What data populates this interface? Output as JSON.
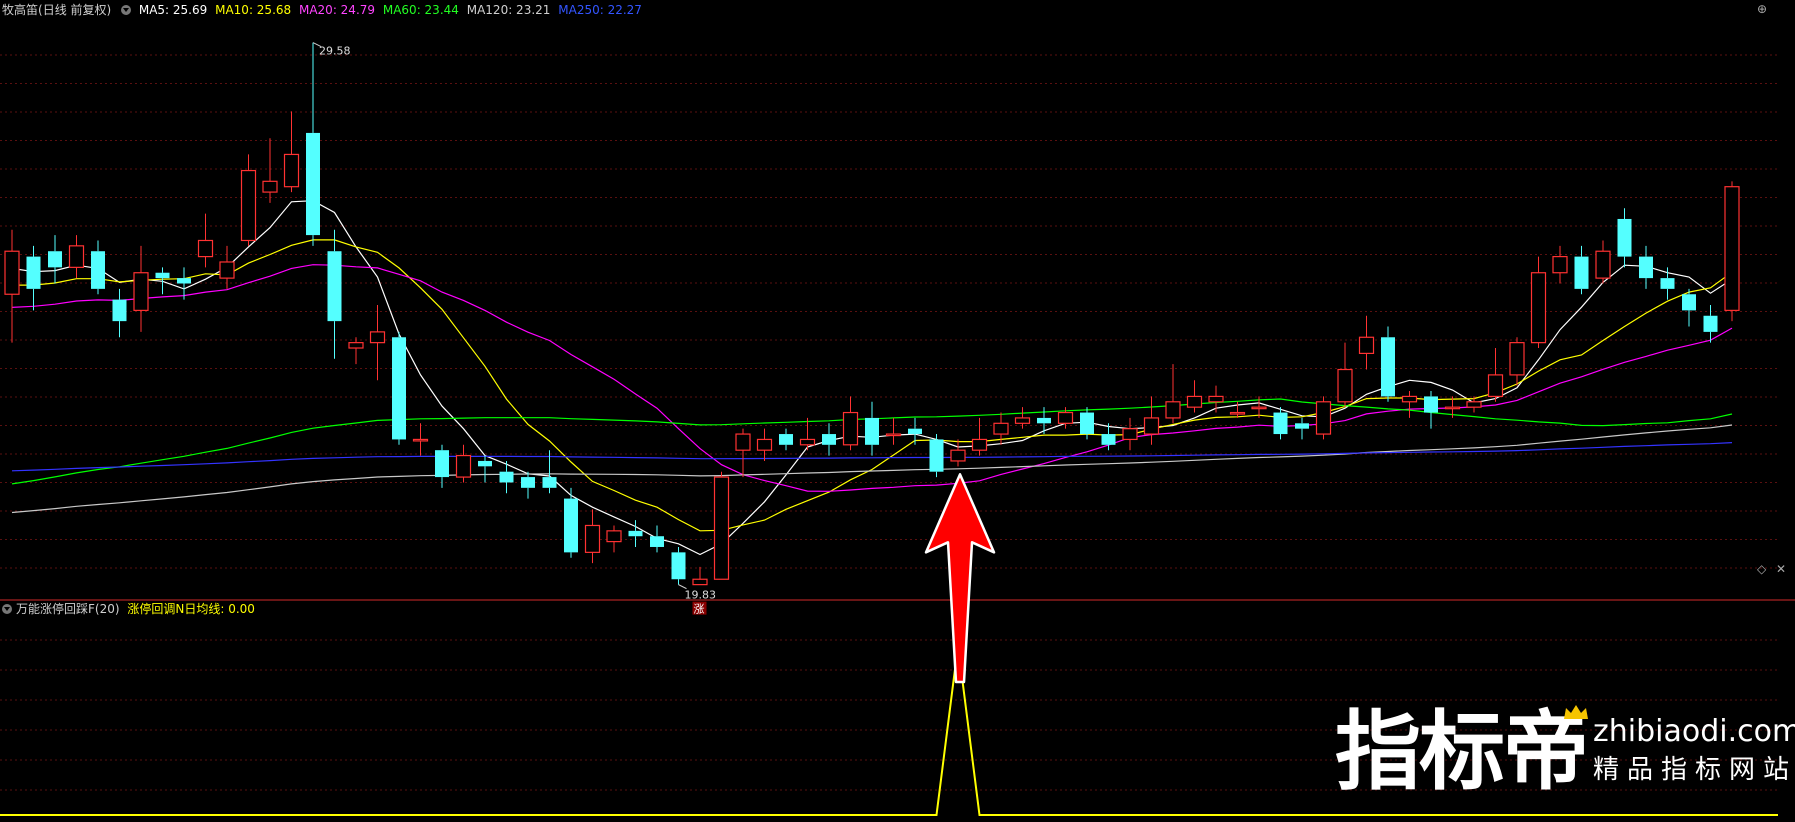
{
  "main_panel": {
    "stock_name": "牧高笛",
    "period": "(日线 前复权)",
    "ma": [
      {
        "label": "MA5: 25.69",
        "color": "#ffffff"
      },
      {
        "label": "MA10: 25.68",
        "color": "#ffff00"
      },
      {
        "label": "MA20: 24.79",
        "color": "#ff00ff"
      },
      {
        "label": "MA60: 23.44",
        "color": "#00ff00"
      },
      {
        "label": "MA120: 23.21",
        "color": "#c8c8c8"
      },
      {
        "label": "MA250: 22.27",
        "color": "#3333ff"
      }
    ],
    "high_label": "29.58",
    "low_label": "19.83",
    "limit_up_tag": "涨"
  },
  "sub_panel": {
    "indicator_name": "万能涨停回踩F(20)",
    "line_label": "涨停回调N日均线: 0.00"
  },
  "watermark": {
    "logo": "指标帝",
    "url": "zhibiaodi.com",
    "tagline": "精品指标网站"
  },
  "chart_data": {
    "type": "candlestick",
    "up_color": "#ff3232",
    "down_color": "#54ffff",
    "candles": [
      [
        24.9,
        25.7,
        26.1,
        24.0
      ],
      [
        25.6,
        25.0,
        25.8,
        24.6
      ],
      [
        25.7,
        25.4,
        26.0,
        25.1
      ],
      [
        25.4,
        25.8,
        26.0,
        25.2
      ],
      [
        25.7,
        25.0,
        25.9,
        24.9
      ],
      [
        24.8,
        24.4,
        25.0,
        24.1
      ],
      [
        24.6,
        25.3,
        25.8,
        24.2
      ],
      [
        25.3,
        25.2,
        25.4,
        24.9
      ],
      [
        25.2,
        25.1,
        25.4,
        24.8
      ],
      [
        25.6,
        25.9,
        26.4,
        25.4
      ],
      [
        25.2,
        25.5,
        25.8,
        25.0
      ],
      [
        25.9,
        27.2,
        27.5,
        25.8
      ],
      [
        26.8,
        27.0,
        27.8,
        26.6
      ],
      [
        26.9,
        27.5,
        28.3,
        26.8
      ],
      [
        27.9,
        26.0,
        29.58,
        25.8
      ],
      [
        25.7,
        24.4,
        26.1,
        23.7
      ],
      [
        23.9,
        24.0,
        24.1,
        23.6
      ],
      [
        24.0,
        24.2,
        24.7,
        23.3
      ],
      [
        24.1,
        22.2,
        24.2,
        22.1
      ],
      [
        22.2,
        22.2,
        22.5,
        21.9
      ],
      [
        22.0,
        21.5,
        22.1,
        21.3
      ],
      [
        21.5,
        21.9,
        22.1,
        21.4
      ],
      [
        21.8,
        21.7,
        21.9,
        21.4
      ],
      [
        21.6,
        21.4,
        21.8,
        21.2
      ],
      [
        21.5,
        21.3,
        21.6,
        21.1
      ],
      [
        21.5,
        21.3,
        22.0,
        21.2
      ],
      [
        21.1,
        20.1,
        21.3,
        20.0
      ],
      [
        20.1,
        20.6,
        20.9,
        19.9
      ],
      [
        20.3,
        20.5,
        20.6,
        20.1
      ],
      [
        20.5,
        20.4,
        20.7,
        20.2
      ],
      [
        20.4,
        20.2,
        20.6,
        20.1
      ],
      [
        20.1,
        19.6,
        20.2,
        19.5
      ],
      [
        19.5,
        19.6,
        19.8,
        19.83
      ],
      [
        19.6,
        21.5,
        21.6,
        19.6
      ],
      [
        22.0,
        22.3,
        22.4,
        21.5
      ],
      [
        22.0,
        22.2,
        22.4,
        21.8
      ],
      [
        22.3,
        22.1,
        22.4,
        22.0
      ],
      [
        22.1,
        22.2,
        22.6,
        22.0
      ],
      [
        22.3,
        22.1,
        22.5,
        21.9
      ],
      [
        22.1,
        22.7,
        23.0,
        22.0
      ],
      [
        22.6,
        22.1,
        22.9,
        21.9
      ],
      [
        22.3,
        22.3,
        22.6,
        22.1
      ],
      [
        22.4,
        22.3,
        22.6,
        22.1
      ],
      [
        22.2,
        21.6,
        22.3,
        21.5
      ],
      [
        21.8,
        22.0,
        22.2,
        21.7
      ],
      [
        22.0,
        22.2,
        22.6,
        21.9
      ],
      [
        22.3,
        22.5,
        22.7,
        22.1
      ],
      [
        22.5,
        22.6,
        22.8,
        22.4
      ],
      [
        22.6,
        22.5,
        22.8,
        22.3
      ],
      [
        22.5,
        22.7,
        22.8,
        22.4
      ],
      [
        22.7,
        22.3,
        22.8,
        22.2
      ],
      [
        22.3,
        22.1,
        22.5,
        22.0
      ],
      [
        22.2,
        22.4,
        22.6,
        22.0
      ],
      [
        22.3,
        22.6,
        23.0,
        22.1
      ],
      [
        22.6,
        22.9,
        23.6,
        22.5
      ],
      [
        22.8,
        23.0,
        23.3,
        22.7
      ],
      [
        22.9,
        23.0,
        23.2,
        22.7
      ],
      [
        22.7,
        22.7,
        22.9,
        22.6
      ],
      [
        22.8,
        22.8,
        23.0,
        22.6
      ],
      [
        22.7,
        22.3,
        22.8,
        22.2
      ],
      [
        22.5,
        22.4,
        22.6,
        22.2
      ],
      [
        22.3,
        22.9,
        23.0,
        22.2
      ],
      [
        22.9,
        23.5,
        24.0,
        22.8
      ],
      [
        23.8,
        24.1,
        24.5,
        23.5
      ],
      [
        24.1,
        23.0,
        24.3,
        22.9
      ],
      [
        22.9,
        23.0,
        23.1,
        22.6
      ],
      [
        23.0,
        22.7,
        23.1,
        22.4
      ],
      [
        22.8,
        22.8,
        23.0,
        22.6
      ],
      [
        22.8,
        22.9,
        23.0,
        22.7
      ],
      [
        23.0,
        23.4,
        23.9,
        22.9
      ],
      [
        23.4,
        24.0,
        24.1,
        23.2
      ],
      [
        24.0,
        25.3,
        25.6,
        23.9
      ],
      [
        25.3,
        25.6,
        25.8,
        25.1
      ],
      [
        25.6,
        25.0,
        25.8,
        24.9
      ],
      [
        25.2,
        25.7,
        25.9,
        25.1
      ],
      [
        26.3,
        25.6,
        26.5,
        25.4
      ],
      [
        25.6,
        25.2,
        25.8,
        25.0
      ],
      [
        25.2,
        25.0,
        25.4,
        24.8
      ],
      [
        24.9,
        24.6,
        25.0,
        24.3
      ],
      [
        24.5,
        24.2,
        24.7,
        24.0
      ],
      [
        24.6,
        26.9,
        27.0,
        24.4
      ]
    ],
    "ma_series": [
      {
        "name": "MA5",
        "color": "#ffffff"
      },
      {
        "name": "MA10",
        "color": "#ffff00"
      },
      {
        "name": "MA20",
        "color": "#ff00ff"
      },
      {
        "name": "MA60",
        "color": "#00ff00"
      },
      {
        "name": "MA120",
        "color": "#c8c8c8"
      },
      {
        "name": "MA250",
        "color": "#3333ff"
      }
    ],
    "ylim": [
      19.4,
      30.0
    ],
    "indicator": {
      "color": "#ffff00",
      "values": [
        0,
        0,
        0,
        0,
        0,
        0,
        0,
        0,
        0,
        0,
        0,
        0,
        0,
        0,
        0,
        0,
        0,
        0,
        0,
        0,
        0,
        0,
        0,
        0,
        0,
        0,
        0,
        0,
        0,
        0,
        0,
        0,
        0,
        0,
        0,
        0,
        0,
        0,
        0,
        0,
        0,
        0,
        0,
        0,
        1,
        0,
        0,
        0,
        0,
        0,
        0,
        0,
        0,
        0,
        0,
        0,
        0,
        0,
        0,
        0,
        0,
        0,
        0,
        0,
        0,
        0,
        0,
        0,
        0,
        0,
        0,
        0,
        0,
        0,
        0,
        0,
        0,
        0,
        0,
        0,
        0
      ],
      "ylim": [
        0,
        1.18
      ]
    },
    "signal_arrow_index": 44
  }
}
